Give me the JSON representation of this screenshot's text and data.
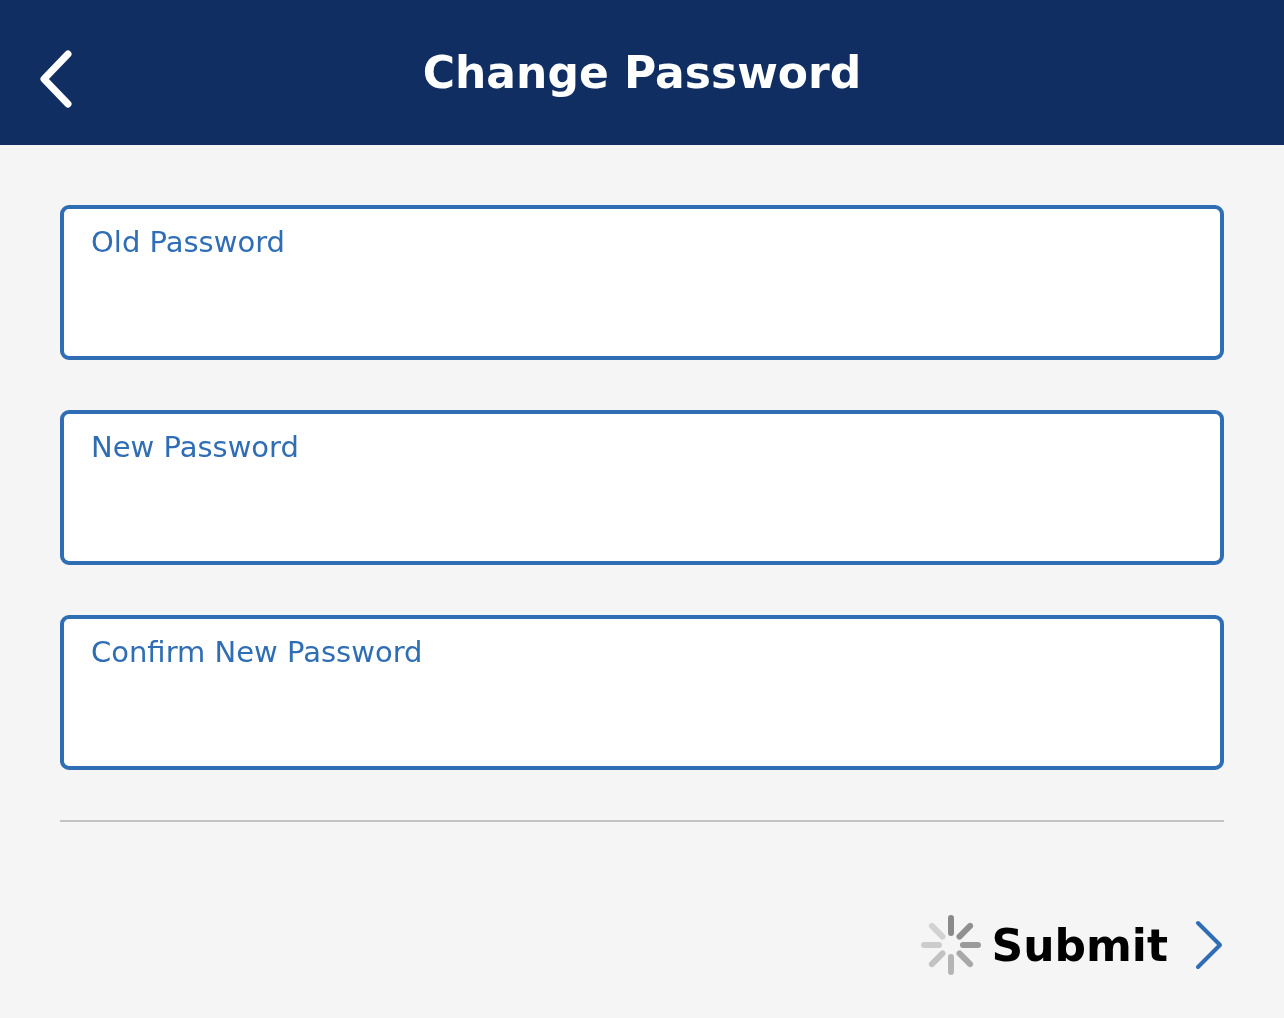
{
  "header": {
    "title": "Change Password"
  },
  "fields": [
    {
      "label": "Old Password"
    },
    {
      "label": "New Password"
    },
    {
      "label": "Confirm New Password"
    }
  ],
  "submit": {
    "label": "Submit",
    "loading": true
  }
}
